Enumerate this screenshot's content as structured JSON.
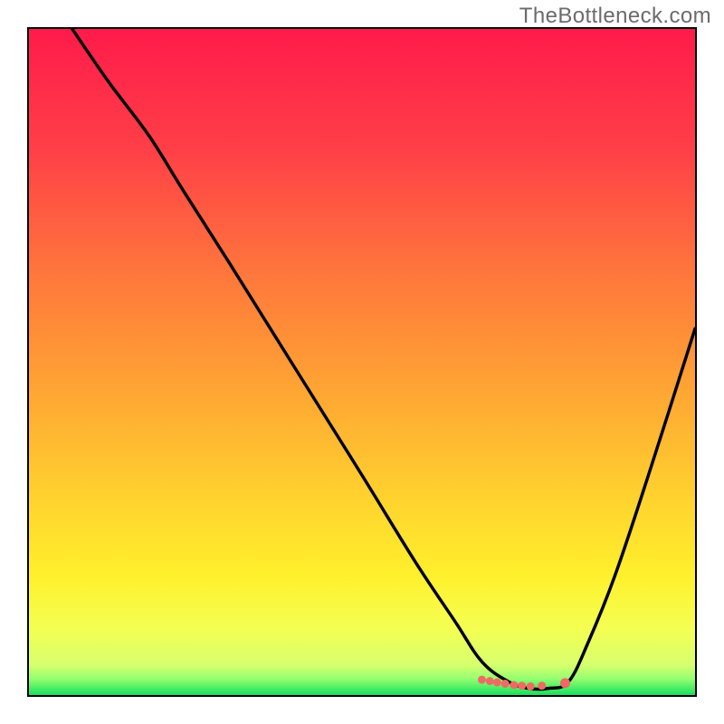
{
  "watermark": {
    "text": "TheBottleneck.com"
  },
  "chart_data": {
    "type": "line",
    "title": "",
    "xlabel": "",
    "ylabel": "",
    "xlim": [
      0,
      100
    ],
    "ylim": [
      0,
      100
    ],
    "grid": false,
    "legend": false,
    "background_gradient_stops": [
      {
        "offset": 0.0,
        "color": "#ff1b4b"
      },
      {
        "offset": 0.18,
        "color": "#ff3f47"
      },
      {
        "offset": 0.38,
        "color": "#ff7a3b"
      },
      {
        "offset": 0.55,
        "color": "#ffa733"
      },
      {
        "offset": 0.7,
        "color": "#ffd12e"
      },
      {
        "offset": 0.82,
        "color": "#fff02c"
      },
      {
        "offset": 0.9,
        "color": "#f4ff52"
      },
      {
        "offset": 0.955,
        "color": "#d7ff6e"
      },
      {
        "offset": 0.975,
        "color": "#97ff70"
      },
      {
        "offset": 1.0,
        "color": "#16e05f"
      }
    ],
    "series": [
      {
        "name": "bottleneck-curve",
        "color": "#000000",
        "x": [
          6.5,
          12,
          18,
          23,
          30,
          40,
          50,
          58,
          64,
          68,
          72,
          75,
          78,
          81,
          84,
          88,
          93,
          100
        ],
        "values": [
          100,
          92,
          84,
          76,
          65,
          49,
          33,
          20,
          11,
          5,
          2,
          1,
          1,
          2,
          8,
          18,
          33,
          55
        ]
      }
    ],
    "markers": {
      "name": "marker-cluster",
      "color": "#ef6a63",
      "points": [
        {
          "x": 68.0,
          "y": 2.3
        },
        {
          "x": 69.2,
          "y": 2.1
        },
        {
          "x": 70.3,
          "y": 1.9
        },
        {
          "x": 71.5,
          "y": 1.7
        },
        {
          "x": 72.8,
          "y": 1.5
        },
        {
          "x": 74.0,
          "y": 1.4
        },
        {
          "x": 75.3,
          "y": 1.3
        },
        {
          "x": 77.0,
          "y": 1.4
        },
        {
          "x": 80.5,
          "y": 1.8
        }
      ]
    }
  }
}
